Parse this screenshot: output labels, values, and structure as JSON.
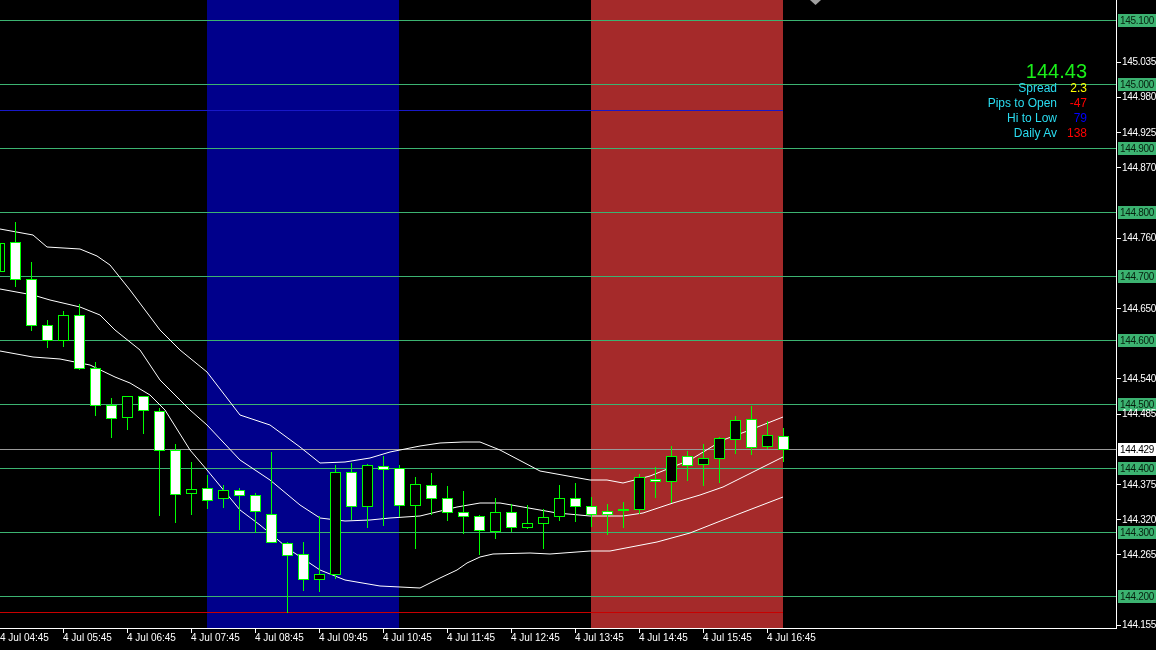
{
  "info_panel": {
    "price": "144.43",
    "rows": [
      {
        "label": "Spread",
        "value": "2.3",
        "color": "#ffff00"
      },
      {
        "label": "Pips to Open",
        "value": "-47",
        "color": "#ff0000"
      },
      {
        "label": "Hi to Low",
        "value": "79",
        "color": "#0000ff"
      },
      {
        "label": "Daily Av",
        "value": "138",
        "color": "#ff0000"
      }
    ]
  },
  "price_axis": {
    "labels": [
      {
        "text": "145.100",
        "kind": "level"
      },
      {
        "text": "145.035",
        "kind": "tick"
      },
      {
        "text": "145.000",
        "kind": "level"
      },
      {
        "text": "144.980",
        "kind": "tick"
      },
      {
        "text": "144.925",
        "kind": "tick"
      },
      {
        "text": "144.900",
        "kind": "level"
      },
      {
        "text": "144.870",
        "kind": "tick"
      },
      {
        "text": "144.800",
        "kind": "level"
      },
      {
        "text": "144.760",
        "kind": "tick"
      },
      {
        "text": "144.700",
        "kind": "level"
      },
      {
        "text": "144.650",
        "kind": "tick"
      },
      {
        "text": "144.600",
        "kind": "level"
      },
      {
        "text": "144.540",
        "kind": "tick"
      },
      {
        "text": "144.500",
        "kind": "level"
      },
      {
        "text": "144.485",
        "kind": "tick"
      },
      {
        "text": "144.429",
        "kind": "current"
      },
      {
        "text": "144.400",
        "kind": "level"
      },
      {
        "text": "144.375",
        "kind": "tick"
      },
      {
        "text": "144.320",
        "kind": "tick"
      },
      {
        "text": "144.300",
        "kind": "level"
      },
      {
        "text": "144.265",
        "kind": "tick"
      },
      {
        "text": "144.200",
        "kind": "level"
      },
      {
        "text": "144.155",
        "kind": "tick"
      }
    ]
  },
  "time_axis": {
    "labels": [
      "4 Jul 04:45",
      "4 Jul 05:45",
      "4 Jul 06:45",
      "4 Jul 07:45",
      "4 Jul 08:45",
      "4 Jul 09:45",
      "4 Jul 10:45",
      "4 Jul 11:45",
      "4 Jul 12:45",
      "4 Jul 13:45",
      "4 Jul 14:45",
      "4 Jul 15:45",
      "4 Jul 16:45"
    ]
  }
}
